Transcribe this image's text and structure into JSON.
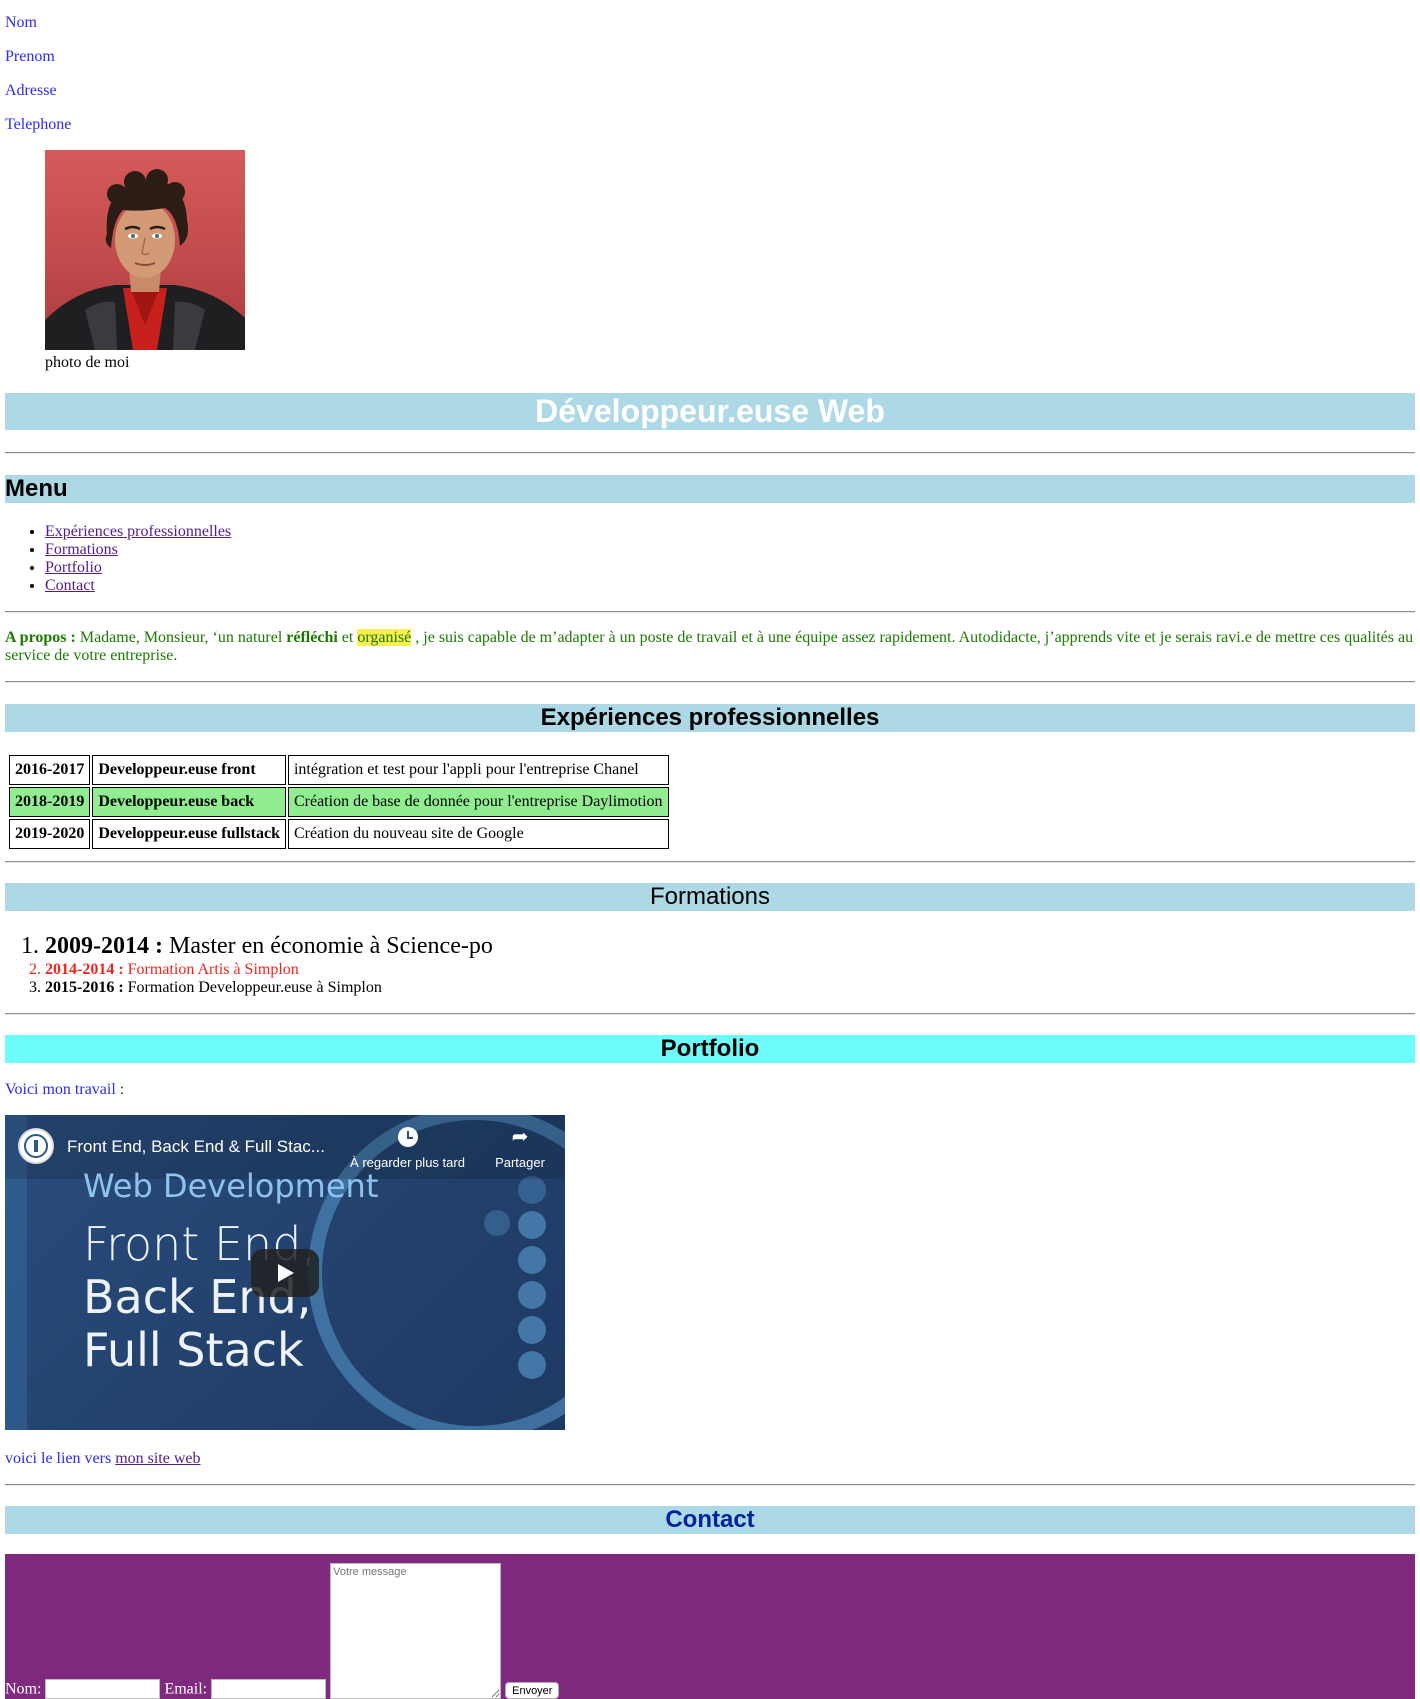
{
  "contact_info": [
    "Nom",
    "Prenom",
    "Adresse",
    "Telephone"
  ],
  "photo": {
    "caption": "photo de moi"
  },
  "title": "Développeur.euse Web",
  "menu": {
    "heading": "Menu",
    "items": [
      "Expériences professionnelles",
      "Formations",
      "Portfolio",
      "Contact"
    ]
  },
  "about": {
    "label": "A propos :",
    "text1": " Madame, Monsieur, ‘un naturel ",
    "strong1": "réfléchi",
    "text2": " et ",
    "mark": "organisé",
    "text3": " , je suis capable de m’adapter à un poste de travail et à une équipe assez rapidement. Autodidacte, j’apprends vite et je serais ravi.e de mettre ces qualités au service de votre entreprise."
  },
  "experiences": {
    "heading": "Expériences professionnelles",
    "rows": [
      {
        "years": "2016-2017",
        "role": "Developpeur.euse front",
        "desc": "intégration et test pour l'appli pour l'entreprise Chanel"
      },
      {
        "years": "2018-2019",
        "role": "Developpeur.euse back",
        "desc": "Création de base de donnée pour l'entreprise Daylimotion"
      },
      {
        "years": "2019-2020",
        "role": "Developpeur.euse fullstack",
        "desc": "Création du nouveau site de Google"
      }
    ]
  },
  "formations": {
    "heading": "Formations",
    "items": [
      {
        "years": "2009-2014 :",
        "text": " Master en économie à Science-po"
      },
      {
        "years": "2014-2014 :",
        "text": " Formation Artis à Simplon"
      },
      {
        "years": "2015-2016 :",
        "text": " Formation Developpeur.euse à Simplon"
      }
    ]
  },
  "portfolio": {
    "heading": "Portfolio",
    "intro": "Voici mon travail :",
    "video": {
      "title": "Front End, Back End & Full Stac...",
      "watch_later": "À regarder plus tard",
      "share": "Partager",
      "line1": "Web Development",
      "line2": "Front End,",
      "line3": "Back End,",
      "line4": "Full Stack"
    },
    "link_prefix": "voici le lien vers ",
    "link_text": "mon site web"
  },
  "contact": {
    "heading": "Contact",
    "name_label": "Nom:",
    "email_label": "Email:",
    "message_placeholder": "Votre message",
    "submit": "Envoyer"
  },
  "colors": {
    "band": "#add8e6",
    "portfolio_band": "#6cfcf9",
    "form_bg": "#7f297f",
    "highlight_row": "#90ee90",
    "link": "#551a8b"
  }
}
